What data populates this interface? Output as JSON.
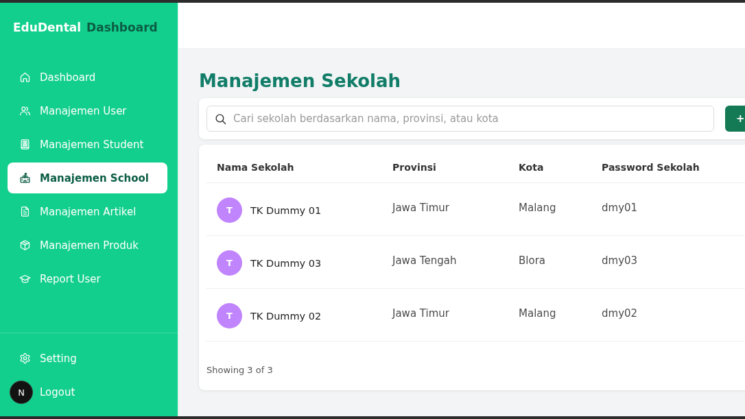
{
  "sidebar": {
    "brand": {
      "name": "EduDental",
      "subtitle": "Dashboard"
    },
    "items": [
      {
        "label": "Dashboard",
        "selected": false
      },
      {
        "label": "Manajemen User",
        "selected": false
      },
      {
        "label": "Manajemen Student",
        "selected": false
      },
      {
        "label": "Manajemen School",
        "selected": true
      },
      {
        "label": "Manajemen Artikel",
        "selected": false
      },
      {
        "label": "Manajemen Produk",
        "selected": false
      },
      {
        "label": "Report User",
        "selected": false
      }
    ],
    "footer_items": [
      {
        "label": "Setting",
        "selected": false
      },
      {
        "label": "Logout",
        "selected": false
      }
    ]
  },
  "overlay_badge": {
    "label": "N"
  },
  "page": {
    "title": "Manajemen Sekolah",
    "search": {
      "placeholder": "Cari sekolah berdasarkan nama, provinsi, atau kota"
    },
    "add_button": {
      "label": "+"
    }
  },
  "table": {
    "columns": [
      "Nama Sekolah",
      "Provinsi",
      "Kota",
      "Password Sekolah"
    ],
    "rows": [
      {
        "avatar": "T",
        "cells": [
          "TK Dummy 01",
          "Jawa Timur",
          "Malang",
          "dmy01"
        ]
      },
      {
        "avatar": "T",
        "cells": [
          "TK Dummy 03",
          "Jawa Tengah",
          "Blora",
          "dmy03"
        ]
      },
      {
        "avatar": "T",
        "cells": [
          "TK Dummy 02",
          "Jawa Timur",
          "Malang",
          "dmy02"
        ]
      }
    ],
    "footer": "Showing 3 of 3"
  }
}
